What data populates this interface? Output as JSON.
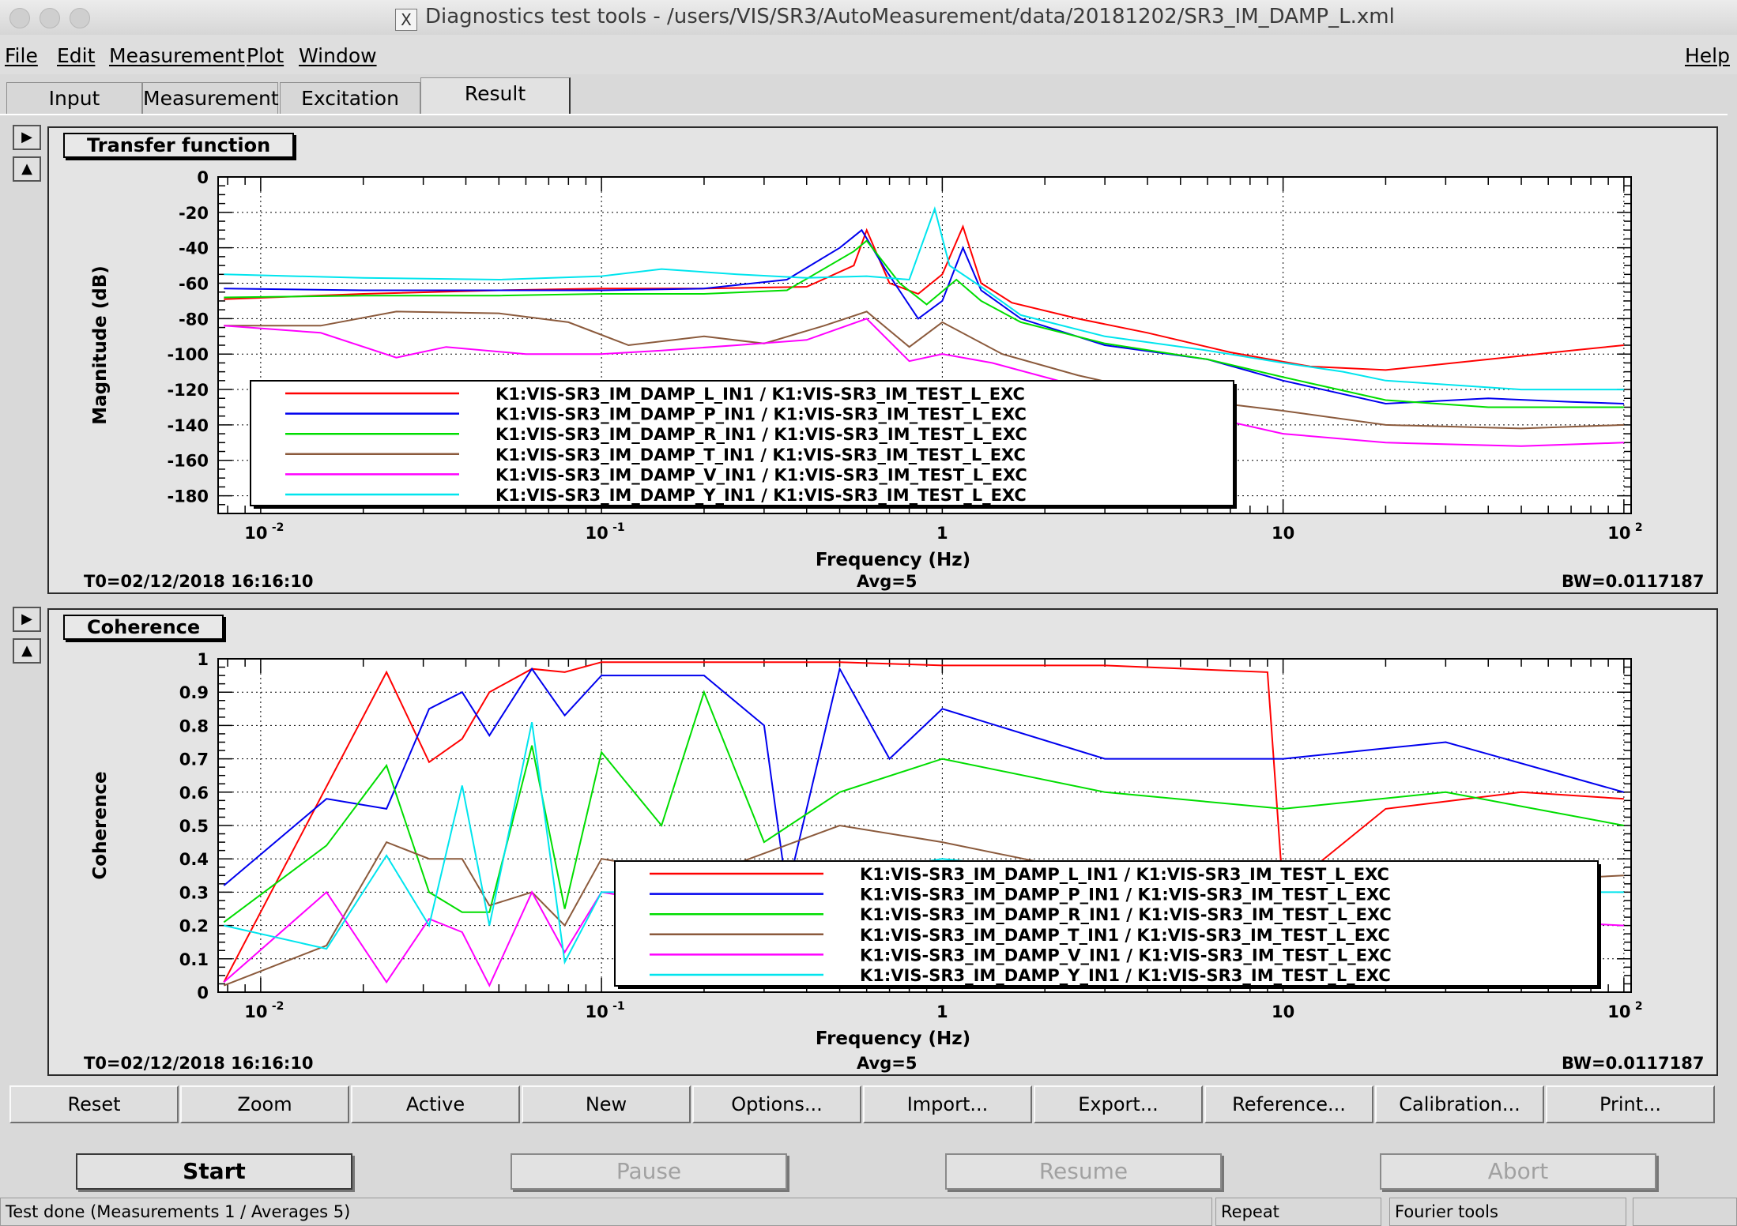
{
  "window": {
    "title": "Diagnostics test tools - /users/VIS/SR3/AutoMeasurement/data/20181202/SR3_IM_DAMP_L.xml",
    "title_icon": "X"
  },
  "menu": {
    "file": "File",
    "edit": "Edit",
    "measurement": "Measurement",
    "plot": "Plot",
    "window": "Window",
    "help": "Help"
  },
  "tabs": [
    "Input",
    "Measurement",
    "Excitation",
    "Result"
  ],
  "active_tab": "Result",
  "side_buttons": {
    "expand": "▶",
    "collapse": "▲"
  },
  "panels": [
    {
      "label": "Transfer function",
      "t0": "T0=02/12/2018 16:16:10",
      "avg": "Avg=5",
      "bw": "BW=0.0117187"
    },
    {
      "label": "Coherence",
      "t0": "T0=02/12/2018 16:16:10",
      "avg": "Avg=5",
      "bw": "BW=0.0117187"
    }
  ],
  "chart_data": [
    {
      "type": "line",
      "xlabel": "Frequency (Hz)",
      "ylabel": "Magnitude (dB)",
      "xscale": "log",
      "xlim": [
        0.0075,
        105
      ],
      "ylim": [
        -190,
        0
      ],
      "x_ticks": [
        {
          "e": "-2",
          "lbl": ""
        },
        {
          "e": "-1",
          "lbl": ""
        },
        {
          "e": "",
          "lbl": "1"
        },
        {
          "e": "",
          "lbl": "10"
        },
        {
          "e": "2",
          "lbl": ""
        }
      ],
      "y_ticks": [
        0,
        -20,
        -40,
        -60,
        -80,
        -100,
        -120,
        -140,
        -160,
        -180
      ],
      "y_tick_labels": [
        "0",
        "-20",
        "-40",
        "-60",
        "-80",
        "-100",
        "-120",
        "-140",
        "-160",
        "-180"
      ],
      "grid": true,
      "legend_position": "bottom-left",
      "series": [
        {
          "name": "K1:VIS-SR3_IM_DAMP_L_IN1 / K1:VIS-SR3_IM_TEST_L_EXC",
          "color": "#ff0000",
          "points": [
            [
              0.0078,
              -69
            ],
            [
              0.02,
              -66
            ],
            [
              0.05,
              -64
            ],
            [
              0.1,
              -63
            ],
            [
              0.2,
              -63
            ],
            [
              0.4,
              -62
            ],
            [
              0.55,
              -50
            ],
            [
              0.6,
              -30
            ],
            [
              0.7,
              -60
            ],
            [
              0.85,
              -66
            ],
            [
              1.0,
              -55
            ],
            [
              1.15,
              -28
            ],
            [
              1.3,
              -60
            ],
            [
              1.6,
              -71
            ],
            [
              2.5,
              -80
            ],
            [
              4,
              -88
            ],
            [
              7,
              -99
            ],
            [
              12,
              -107
            ],
            [
              20,
              -109
            ],
            [
              40,
              -103
            ],
            [
              70,
              -98
            ],
            [
              100,
              -95
            ]
          ]
        },
        {
          "name": "K1:VIS-SR3_IM_DAMP_P_IN1 / K1:VIS-SR3_IM_TEST_L_EXC",
          "color": "#0000ee",
          "points": [
            [
              0.0078,
              -63
            ],
            [
              0.02,
              -64
            ],
            [
              0.05,
              -64
            ],
            [
              0.1,
              -64
            ],
            [
              0.2,
              -63
            ],
            [
              0.35,
              -58
            ],
            [
              0.5,
              -40
            ],
            [
              0.58,
              -30
            ],
            [
              0.68,
              -52
            ],
            [
              0.85,
              -80
            ],
            [
              1.0,
              -70
            ],
            [
              1.15,
              -40
            ],
            [
              1.3,
              -64
            ],
            [
              1.7,
              -80
            ],
            [
              3,
              -95
            ],
            [
              6,
              -103
            ],
            [
              10,
              -115
            ],
            [
              20,
              -128
            ],
            [
              40,
              -125
            ],
            [
              70,
              -127
            ],
            [
              100,
              -128
            ]
          ]
        },
        {
          "name": "K1:VIS-SR3_IM_DAMP_R_IN1 / K1:VIS-SR3_IM_TEST_L_EXC",
          "color": "#00dd00",
          "points": [
            [
              0.0078,
              -68
            ],
            [
              0.02,
              -67
            ],
            [
              0.05,
              -67
            ],
            [
              0.1,
              -66
            ],
            [
              0.2,
              -66
            ],
            [
              0.35,
              -64
            ],
            [
              0.55,
              -42
            ],
            [
              0.6,
              -36
            ],
            [
              0.75,
              -60
            ],
            [
              0.9,
              -72
            ],
            [
              1.1,
              -58
            ],
            [
              1.3,
              -70
            ],
            [
              1.7,
              -82
            ],
            [
              3,
              -94
            ],
            [
              6,
              -103
            ],
            [
              10,
              -113
            ],
            [
              20,
              -126
            ],
            [
              40,
              -130
            ],
            [
              70,
              -130
            ],
            [
              100,
              -130
            ]
          ]
        },
        {
          "name": "K1:VIS-SR3_IM_DAMP_T_IN1 / K1:VIS-SR3_IM_TEST_L_EXC",
          "color": "#8b5a3c",
          "points": [
            [
              0.0078,
              -84
            ],
            [
              0.015,
              -84
            ],
            [
              0.025,
              -76
            ],
            [
              0.05,
              -77
            ],
            [
              0.08,
              -82
            ],
            [
              0.12,
              -95
            ],
            [
              0.2,
              -90
            ],
            [
              0.3,
              -94
            ],
            [
              0.45,
              -84
            ],
            [
              0.6,
              -76
            ],
            [
              0.8,
              -96
            ],
            [
              1.0,
              -82
            ],
            [
              1.5,
              -100
            ],
            [
              2.5,
              -112
            ],
            [
              5,
              -125
            ],
            [
              10,
              -132
            ],
            [
              20,
              -140
            ],
            [
              50,
              -142
            ],
            [
              100,
              -140
            ]
          ]
        },
        {
          "name": "K1:VIS-SR3_IM_DAMP_V_IN1 / K1:VIS-SR3_IM_TEST_L_EXC",
          "color": "#ff00ff",
          "points": [
            [
              0.0078,
              -84
            ],
            [
              0.015,
              -88
            ],
            [
              0.025,
              -102
            ],
            [
              0.035,
              -96
            ],
            [
              0.06,
              -100
            ],
            [
              0.1,
              -100
            ],
            [
              0.15,
              -98
            ],
            [
              0.25,
              -95
            ],
            [
              0.4,
              -92
            ],
            [
              0.6,
              -80
            ],
            [
              0.8,
              -104
            ],
            [
              1.0,
              -100
            ],
            [
              1.4,
              -105
            ],
            [
              2.5,
              -118
            ],
            [
              5,
              -132
            ],
            [
              10,
              -145
            ],
            [
              20,
              -150
            ],
            [
              50,
              -152
            ],
            [
              100,
              -150
            ]
          ]
        },
        {
          "name": "K1:VIS-SR3_IM_DAMP_Y_IN1 / K1:VIS-SR3_IM_TEST_L_EXC",
          "color": "#00e5ee",
          "points": [
            [
              0.0078,
              -55
            ],
            [
              0.02,
              -57
            ],
            [
              0.05,
              -58
            ],
            [
              0.1,
              -56
            ],
            [
              0.15,
              -52
            ],
            [
              0.25,
              -55
            ],
            [
              0.4,
              -57
            ],
            [
              0.6,
              -56
            ],
            [
              0.8,
              -58
            ],
            [
              0.95,
              -18
            ],
            [
              1.05,
              -50
            ],
            [
              1.3,
              -62
            ],
            [
              1.7,
              -78
            ],
            [
              3,
              -90
            ],
            [
              6,
              -98
            ],
            [
              10,
              -105
            ],
            [
              15,
              -110
            ],
            [
              20,
              -115
            ],
            [
              50,
              -120
            ],
            [
              100,
              -120
            ]
          ]
        }
      ]
    },
    {
      "type": "line",
      "xlabel": "Frequency (Hz)",
      "ylabel": "Coherence",
      "xscale": "log",
      "xlim": [
        0.0075,
        105
      ],
      "ylim": [
        0,
        1
      ],
      "x_ticks": [
        {
          "e": "-2",
          "lbl": ""
        },
        {
          "e": "-1",
          "lbl": ""
        },
        {
          "e": "",
          "lbl": "1"
        },
        {
          "e": "",
          "lbl": "10"
        },
        {
          "e": "2",
          "lbl": ""
        }
      ],
      "y_ticks": [
        0,
        0.1,
        0.2,
        0.3,
        0.4,
        0.5,
        0.6,
        0.7,
        0.8,
        0.9,
        1
      ],
      "y_tick_labels": [
        "0",
        "0.1",
        "0.2",
        "0.3",
        "0.4",
        "0.5",
        "0.6",
        "0.7",
        "0.8",
        "0.9",
        "1"
      ],
      "grid": true,
      "legend_position": "bottom-right",
      "series": [
        {
          "name": "K1:VIS-SR3_IM_DAMP_L_IN1 / K1:VIS-SR3_IM_TEST_L_EXC",
          "color": "#ff0000",
          "points": [
            [
              0.0078,
              0.03
            ],
            [
              0.0234,
              0.96
            ],
            [
              0.0312,
              0.69
            ],
            [
              0.039,
              0.76
            ],
            [
              0.0469,
              0.9
            ],
            [
              0.0625,
              0.97
            ],
            [
              0.078,
              0.96
            ],
            [
              0.1,
              0.99
            ],
            [
              0.2,
              0.99
            ],
            [
              0.5,
              0.99
            ],
            [
              1,
              0.98
            ],
            [
              3,
              0.98
            ],
            [
              9,
              0.96
            ],
            [
              10,
              0.3
            ],
            [
              20,
              0.55
            ],
            [
              50,
              0.6
            ],
            [
              100,
              0.58
            ]
          ]
        },
        {
          "name": "K1:VIS-SR3_IM_DAMP_P_IN1 / K1:VIS-SR3_IM_TEST_L_EXC",
          "color": "#0000ee",
          "points": [
            [
              0.0078,
              0.32
            ],
            [
              0.0156,
              0.58
            ],
            [
              0.0234,
              0.55
            ],
            [
              0.0312,
              0.85
            ],
            [
              0.039,
              0.9
            ],
            [
              0.0469,
              0.77
            ],
            [
              0.0625,
              0.97
            ],
            [
              0.078,
              0.83
            ],
            [
              0.1,
              0.95
            ],
            [
              0.2,
              0.95
            ],
            [
              0.3,
              0.8
            ],
            [
              0.35,
              0.3
            ],
            [
              0.5,
              0.97
            ],
            [
              0.7,
              0.7
            ],
            [
              1,
              0.85
            ],
            [
              3,
              0.7
            ],
            [
              10,
              0.7
            ],
            [
              30,
              0.75
            ],
            [
              100,
              0.6
            ]
          ]
        },
        {
          "name": "K1:VIS-SR3_IM_DAMP_R_IN1 / K1:VIS-SR3_IM_TEST_L_EXC",
          "color": "#00dd00",
          "points": [
            [
              0.0078,
              0.21
            ],
            [
              0.0156,
              0.44
            ],
            [
              0.0234,
              0.68
            ],
            [
              0.0312,
              0.3
            ],
            [
              0.039,
              0.24
            ],
            [
              0.0469,
              0.24
            ],
            [
              0.0625,
              0.74
            ],
            [
              0.078,
              0.25
            ],
            [
              0.1,
              0.72
            ],
            [
              0.15,
              0.5
            ],
            [
              0.2,
              0.9
            ],
            [
              0.3,
              0.45
            ],
            [
              0.5,
              0.6
            ],
            [
              1,
              0.7
            ],
            [
              3,
              0.6
            ],
            [
              10,
              0.55
            ],
            [
              30,
              0.6
            ],
            [
              100,
              0.5
            ]
          ]
        },
        {
          "name": "K1:VIS-SR3_IM_DAMP_T_IN1 / K1:VIS-SR3_IM_TEST_L_EXC",
          "color": "#8b5a3c",
          "points": [
            [
              0.0078,
              0.02
            ],
            [
              0.0156,
              0.14
            ],
            [
              0.0234,
              0.45
            ],
            [
              0.0312,
              0.4
            ],
            [
              0.039,
              0.4
            ],
            [
              0.0469,
              0.26
            ],
            [
              0.0625,
              0.3
            ],
            [
              0.078,
              0.2
            ],
            [
              0.1,
              0.4
            ],
            [
              0.2,
              0.35
            ],
            [
              0.5,
              0.5
            ],
            [
              1,
              0.45
            ],
            [
              3,
              0.35
            ],
            [
              10,
              0.3
            ],
            [
              100,
              0.35
            ]
          ]
        },
        {
          "name": "K1:VIS-SR3_IM_DAMP_V_IN1 / K1:VIS-SR3_IM_TEST_L_EXC",
          "color": "#ff00ff",
          "points": [
            [
              0.0078,
              0.03
            ],
            [
              0.0156,
              0.3
            ],
            [
              0.0234,
              0.03
            ],
            [
              0.0312,
              0.22
            ],
            [
              0.039,
              0.18
            ],
            [
              0.0469,
              0.02
            ],
            [
              0.0625,
              0.3
            ],
            [
              0.078,
              0.12
            ],
            [
              0.1,
              0.3
            ],
            [
              0.2,
              0.25
            ],
            [
              0.5,
              0.3
            ],
            [
              1,
              0.35
            ],
            [
              3,
              0.3
            ],
            [
              10,
              0.25
            ],
            [
              100,
              0.2
            ]
          ]
        },
        {
          "name": "K1:VIS-SR3_IM_DAMP_Y_IN1 / K1:VIS-SR3_IM_TEST_L_EXC",
          "color": "#00e5ee",
          "points": [
            [
              0.0078,
              0.2
            ],
            [
              0.0156,
              0.13
            ],
            [
              0.0234,
              0.41
            ],
            [
              0.0312,
              0.2
            ],
            [
              0.039,
              0.62
            ],
            [
              0.0469,
              0.2
            ],
            [
              0.0625,
              0.81
            ],
            [
              0.078,
              0.09
            ],
            [
              0.1,
              0.3
            ],
            [
              0.2,
              0.3
            ],
            [
              0.5,
              0.35
            ],
            [
              1,
              0.4
            ],
            [
              3,
              0.35
            ],
            [
              10,
              0.3
            ],
            [
              100,
              0.3
            ]
          ]
        }
      ]
    }
  ],
  "toolbar": [
    "Reset",
    "Zoom",
    "Active",
    "New",
    "Options...",
    "Import...",
    "Export...",
    "Reference...",
    "Calibration...",
    "Print..."
  ],
  "actions": [
    "Start",
    "Pause",
    "Resume",
    "Abort"
  ],
  "status": {
    "message": "Test done (Measurements 1 / Averages 5)",
    "mode": "Repeat",
    "tool": "Fourier tools",
    "extra": ""
  }
}
